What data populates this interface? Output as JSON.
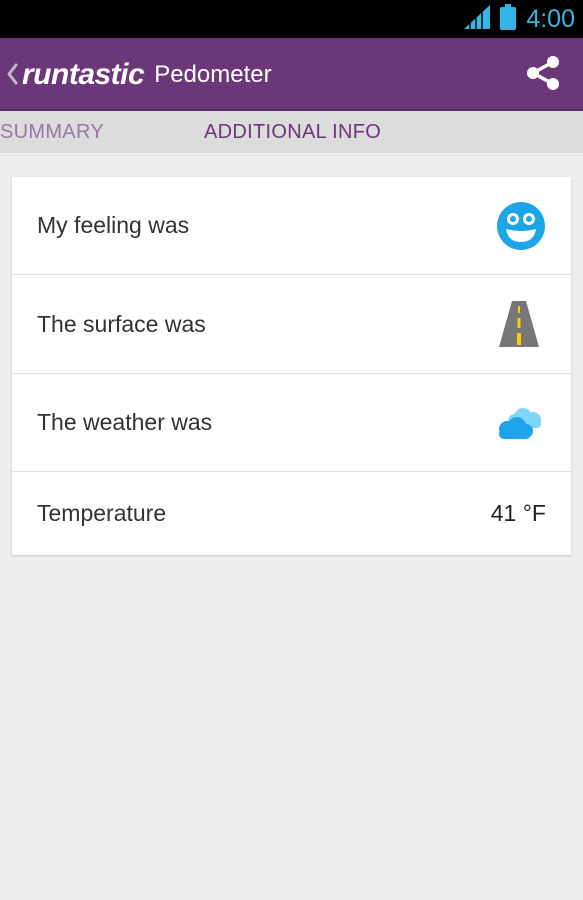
{
  "status_bar": {
    "time": "4:00",
    "icons": [
      "signal-icon",
      "battery-icon"
    ],
    "accent_color": "#33b5e5"
  },
  "action_bar": {
    "brand": "runtastic",
    "app_name": "Pedometer",
    "icons": [
      "back-chevron-icon",
      "share-icon"
    ],
    "color": "#6b3779"
  },
  "tabs": [
    {
      "label": "SUMMARY",
      "selected": false
    },
    {
      "label": "ADDITIONAL INFO",
      "selected": true
    }
  ],
  "info_rows": [
    {
      "label": "My feeling was",
      "icon": "smiley-face-icon"
    },
    {
      "label": "The surface was",
      "icon": "road-icon"
    },
    {
      "label": "The weather was",
      "icon": "cloudy-icon"
    },
    {
      "label": "Temperature",
      "value": "41 °F"
    }
  ]
}
